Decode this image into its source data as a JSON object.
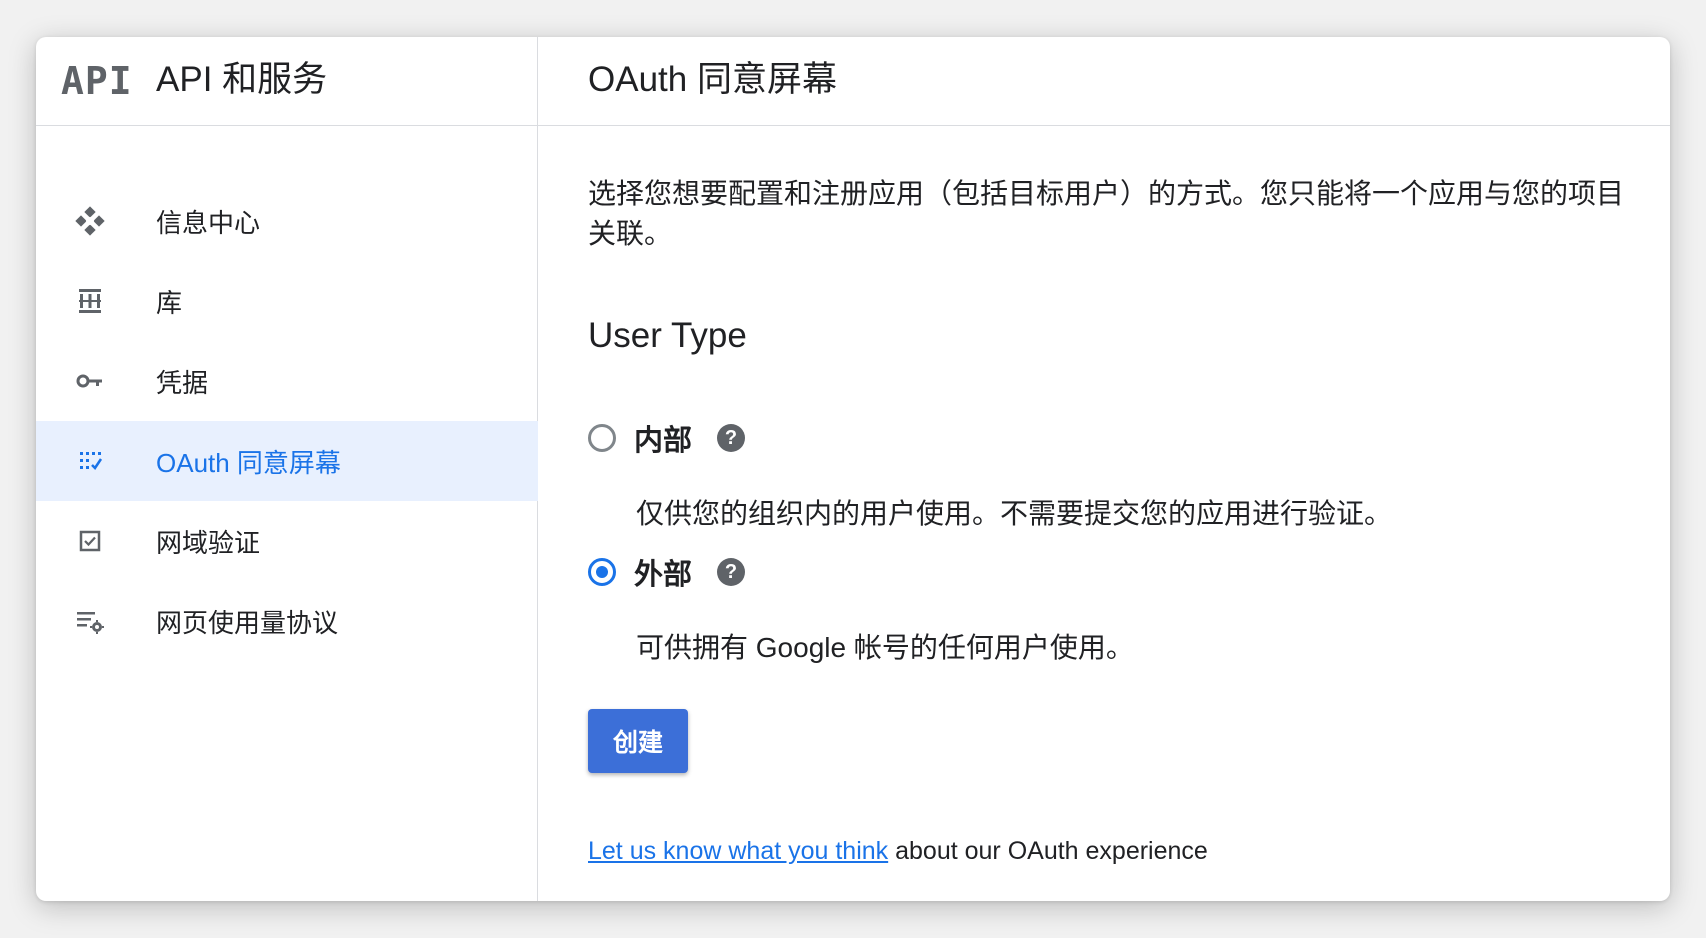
{
  "sidebar": {
    "logo": "API",
    "title": "API 和服务",
    "items": [
      {
        "label": "信息中心",
        "icon": "dashboard-icon"
      },
      {
        "label": "库",
        "icon": "library-icon"
      },
      {
        "label": "凭据",
        "icon": "key-icon"
      },
      {
        "label": "OAuth 同意屏幕",
        "icon": "oauth-consent-icon",
        "active": true
      },
      {
        "label": "网域验证",
        "icon": "checkbox-icon"
      },
      {
        "label": "网页使用量协议",
        "icon": "settings-list-icon"
      }
    ]
  },
  "main": {
    "title": "OAuth 同意屏幕",
    "description": "选择您想要配置和注册应用（包括目标用户）的方式。您只能将一个应用与您的项目关联。",
    "user_type": {
      "heading": "User Type",
      "options": [
        {
          "label": "内部",
          "help": "?",
          "description": "仅供您的组织内的用户使用。不需要提交您的应用进行验证。",
          "selected": false
        },
        {
          "label": "外部",
          "help": "?",
          "description": "可供拥有 Google 帐号的任何用户使用。",
          "selected": true
        }
      ]
    },
    "create_button": "创建",
    "feedback": {
      "link": "Let us know what you think",
      "text": " about our OAuth experience"
    }
  },
  "colors": {
    "accent": "#1a73e8",
    "button": "#3c6fd8",
    "active_bg": "#e8f0fe"
  }
}
